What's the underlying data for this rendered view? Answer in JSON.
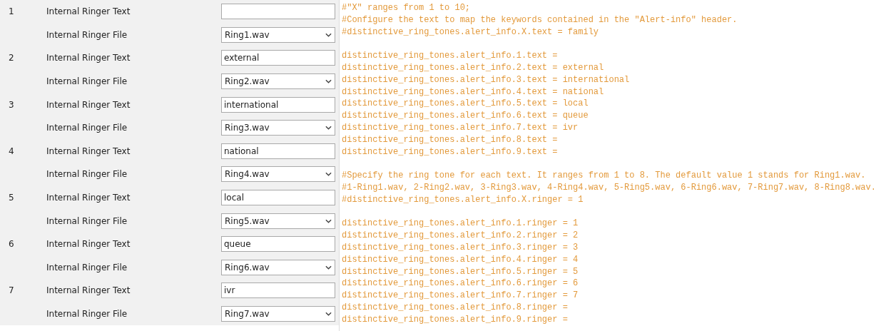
{
  "ringers": [
    {
      "number": "1",
      "text_label": "Internal Ringer Text",
      "file_label": "Internal Ringer File",
      "file_value": "Ring1.wav"
    },
    {
      "number": "2",
      "text_label": "Internal Ringer Text",
      "text_value": "external",
      "file_label": "Internal Ringer File",
      "file_value": "Ring2.wav"
    },
    {
      "number": "3",
      "text_label": "Internal Ringer Text",
      "text_value": "international",
      "file_label": "Internal Ringer File",
      "file_value": "Ring3.wav"
    },
    {
      "number": "4",
      "text_label": "Internal Ringer Text",
      "text_value": "national",
      "file_label": "Internal Ringer File",
      "file_value": "Ring4.wav"
    },
    {
      "number": "5",
      "text_label": "Internal Ringer Text",
      "text_value": "local",
      "file_label": "Internal Ringer File",
      "file_value": "Ring5.wav"
    },
    {
      "number": "6",
      "text_label": "Internal Ringer Text",
      "text_value": "queue",
      "file_label": "Internal Ringer File",
      "file_value": "Ring6.wav"
    },
    {
      "number": "7",
      "text_label": "Internal Ringer Text",
      "text_value": "ivr",
      "file_label": "Internal Ringer File",
      "file_value": "Ring7.wav"
    }
  ],
  "config_blocks": [
    [
      "#\"X\" ranges from 1 to 10;",
      "#Configure the text to map the keywords contained in the \"Alert-info\" header.",
      "#distinctive_ring_tones.alert_info.X.text = family"
    ],
    [
      "distinctive_ring_tones.alert_info.1.text =",
      "distinctive_ring_tones.alert_info.2.text = external",
      "distinctive_ring_tones.alert_info.3.text = international",
      "distinctive_ring_tones.alert_info.4.text = national",
      "distinctive_ring_tones.alert_info.5.text = local",
      "distinctive_ring_tones.alert_info.6.text = queue",
      "distinctive_ring_tones.alert_info.7.text = ivr",
      "distinctive_ring_tones.alert_info.8.text =",
      "distinctive_ring_tones.alert_info.9.text ="
    ],
    [
      "#Specify the ring tone for each text. It ranges from 1 to 8. The default value 1 stands for Ring1.wav.",
      "#1-Ring1.wav, 2-Ring2.wav, 3-Ring3.wav, 4-Ring4.wav, 5-Ring5.wav, 6-Ring6.wav, 7-Ring7.wav, 8-Ring8.wav.",
      "#distinctive_ring_tones.alert_info.X.ringer = 1"
    ],
    [
      "distinctive_ring_tones.alert_info.1.ringer = 1",
      "distinctive_ring_tones.alert_info.2.ringer = 2",
      "distinctive_ring_tones.alert_info.3.ringer = 3",
      "distinctive_ring_tones.alert_info.4.ringer = 4",
      "distinctive_ring_tones.alert_info.5.ringer = 5",
      "distinctive_ring_tones.alert_info.6.ringer = 6",
      "distinctive_ring_tones.alert_info.7.ringer = 7",
      "distinctive_ring_tones.alert_info.8.ringer =",
      "distinctive_ring_tones.alert_info.9.ringer ="
    ]
  ]
}
